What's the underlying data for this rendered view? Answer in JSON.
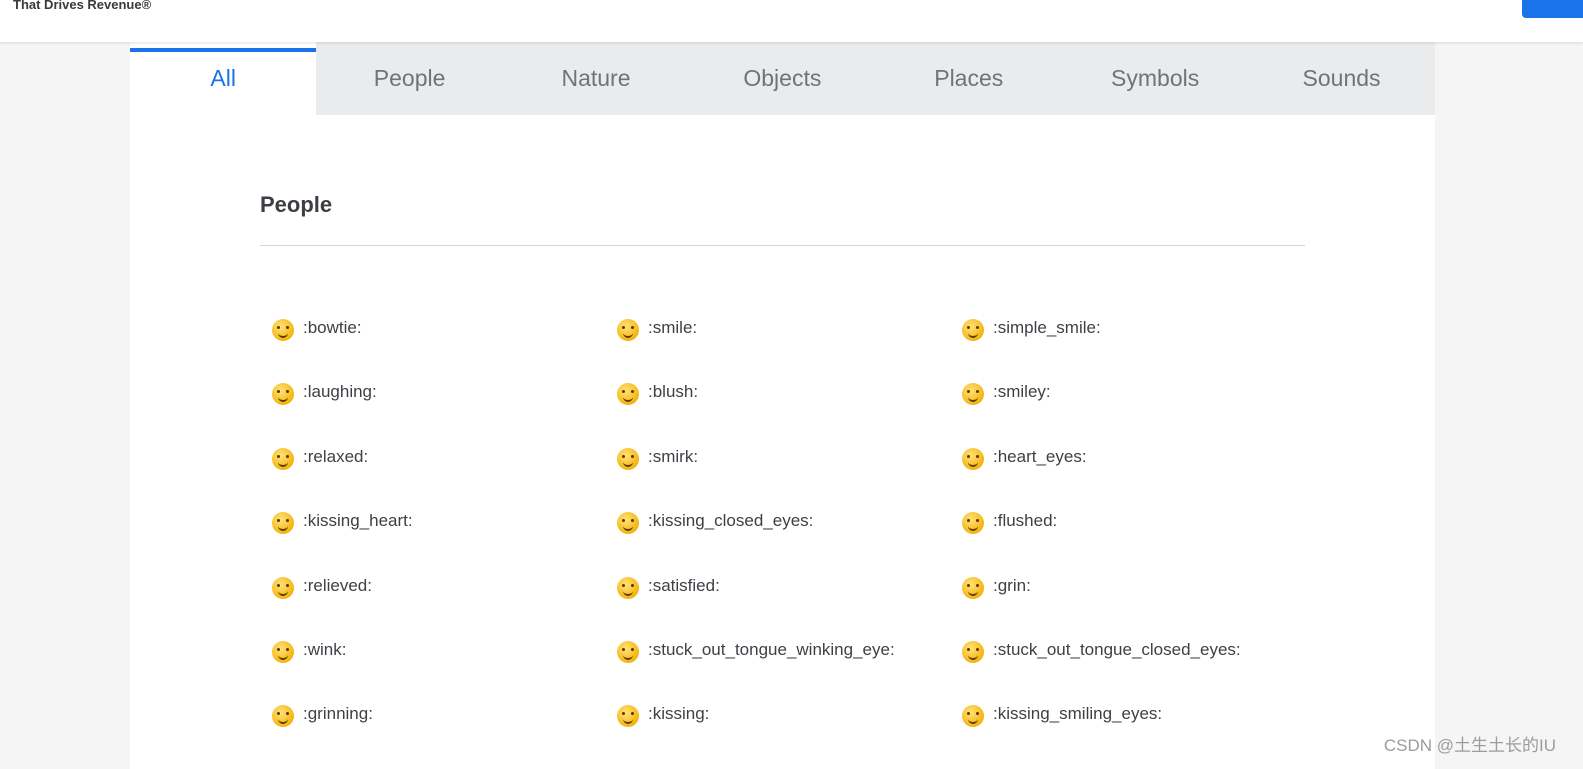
{
  "header": {
    "tagline": "That Drives Revenue®"
  },
  "tabs": [
    {
      "label": "All",
      "active": true
    },
    {
      "label": "People",
      "active": false
    },
    {
      "label": "Nature",
      "active": false
    },
    {
      "label": "Objects",
      "active": false
    },
    {
      "label": "Places",
      "active": false
    },
    {
      "label": "Symbols",
      "active": false
    },
    {
      "label": "Sounds",
      "active": false
    }
  ],
  "section": {
    "title": "People"
  },
  "emojis": [
    {
      "code": ":bowtie:",
      "icon": "bowtie-icon"
    },
    {
      "code": ":smile:",
      "icon": "smile-icon"
    },
    {
      "code": ":simple_smile:",
      "icon": "simple-smile-icon"
    },
    {
      "code": ":laughing:",
      "icon": "laughing-icon"
    },
    {
      "code": ":blush:",
      "icon": "blush-icon"
    },
    {
      "code": ":smiley:",
      "icon": "smiley-icon"
    },
    {
      "code": ":relaxed:",
      "icon": "relaxed-icon"
    },
    {
      "code": ":smirk:",
      "icon": "smirk-icon"
    },
    {
      "code": ":heart_eyes:",
      "icon": "heart-eyes-icon"
    },
    {
      "code": ":kissing_heart:",
      "icon": "kissing-heart-icon"
    },
    {
      "code": ":kissing_closed_eyes:",
      "icon": "kissing-closed-eyes-icon"
    },
    {
      "code": ":flushed:",
      "icon": "flushed-icon"
    },
    {
      "code": ":relieved:",
      "icon": "relieved-icon"
    },
    {
      "code": ":satisfied:",
      "icon": "satisfied-icon"
    },
    {
      "code": ":grin:",
      "icon": "grin-icon"
    },
    {
      "code": ":wink:",
      "icon": "wink-icon"
    },
    {
      "code": ":stuck_out_tongue_winking_eye:",
      "icon": "stuck-out-tongue-winking-eye-icon"
    },
    {
      "code": ":stuck_out_tongue_closed_eyes:",
      "icon": "stuck-out-tongue-closed-eyes-icon"
    },
    {
      "code": ":grinning:",
      "icon": "grinning-icon"
    },
    {
      "code": ":kissing:",
      "icon": "kissing-icon"
    },
    {
      "code": ":kissing_smiling_eyes:",
      "icon": "kissing-smiling-eyes-icon"
    }
  ],
  "watermark": "CSDN @土生土长的IU",
  "colors": {
    "accent": "#1a73e8",
    "tab_bg": "#e9ebed",
    "emoji_yellow": "#f6b40e"
  }
}
